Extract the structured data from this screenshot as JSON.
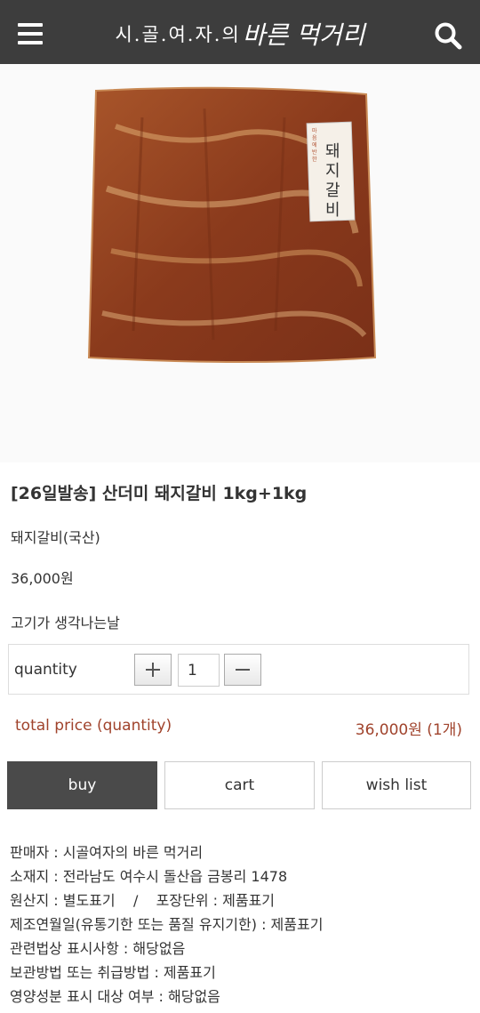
{
  "header": {
    "logo_main": "시.골.여.자.의",
    "logo_script": "바른 먹거리",
    "menu_icon": "hamburger-menu-icon",
    "search_icon": "search-icon"
  },
  "product": {
    "image_alt": "돼지갈비 package",
    "package_label": "돼지갈비",
    "package_sublabel": "마음에 반한",
    "title": "[26일발송] 산더미 돼지갈비 1kg+1kg",
    "subtitle": "돼지갈비(국산)",
    "price": "36,000원",
    "tagline": "고기가 생각나는날"
  },
  "quantity": {
    "label": "quantity",
    "value": "1"
  },
  "total": {
    "label": "total price (quantity)",
    "value": "36,000원 (1개)"
  },
  "actions": {
    "buy": "buy",
    "cart": "cart",
    "wish": "wish list"
  },
  "info": [
    "판매자 : 시골여자의 바른 먹거리",
    "소재지 : 전라남도 여수시 돌산읍 금봉리 1478",
    "원산지 : 별도표기    /    포장단위 : 제품표기",
    "제조연월일(유통기한 또는 품질 유지기한) : 제품표기",
    "관련법상 표시사항 : 해당없음",
    "보관방법 또는 취급방법 : 제품표기",
    "영양성분 표시 대상 여부 : 해당없음"
  ],
  "colors": {
    "header_bg": "#3d3d3d",
    "accent": "#a0432c",
    "buy_bg": "#4a4a4a"
  }
}
